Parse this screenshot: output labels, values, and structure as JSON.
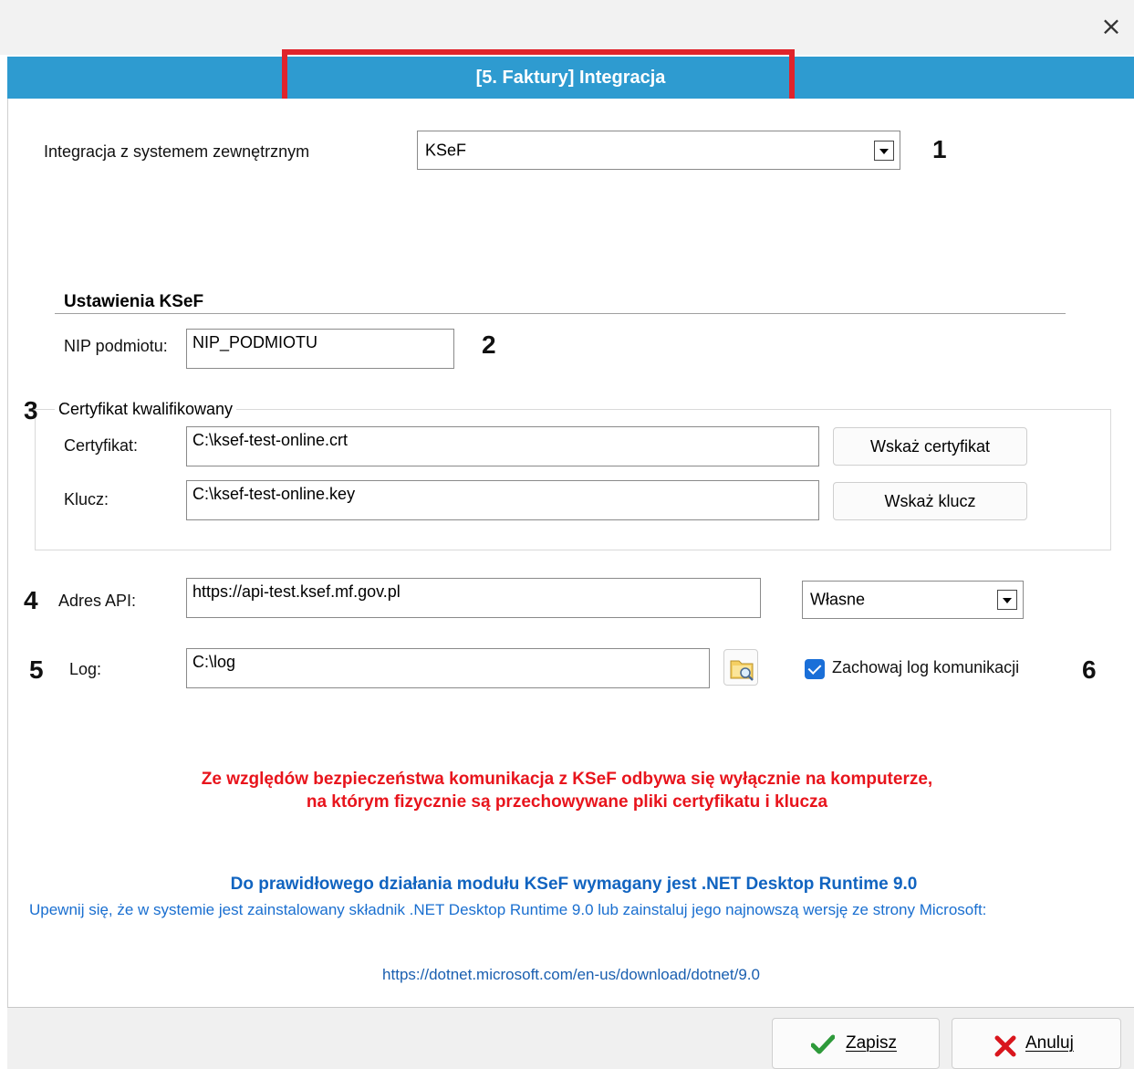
{
  "window": {
    "close_symbol": "×",
    "header_title": "[5. Faktury] Integracja"
  },
  "integration": {
    "label": "Integracja z systemem zewnętrznym",
    "selected": "KSeF",
    "marker": "1"
  },
  "ksef_settings": {
    "section_title": "Ustawienia KSeF",
    "nip_label": "NIP podmiotu:",
    "nip_value": "NIP_PODMIOTU",
    "nip_marker": "2"
  },
  "certificate": {
    "group_label": "Certyfikat kwalifikowany",
    "marker": "3",
    "cert_label": "Certyfikat:",
    "cert_value": "C:\\ksef-test-online.crt",
    "cert_button": "Wskaż certyfikat",
    "key_label": "Klucz:",
    "key_value": "C:\\ksef-test-online.key",
    "key_button": "Wskaż klucz"
  },
  "api": {
    "marker": "4",
    "label": "Adres API:",
    "value": "https://api-test.ksef.mf.gov.pl",
    "mode_selected": "Własne"
  },
  "log": {
    "marker": "5",
    "label": "Log:",
    "value": "C:\\log",
    "keep_log_label": "Zachowaj log komunikacji",
    "keep_log_checked": true,
    "keep_marker": "6"
  },
  "warning": {
    "line1": "Ze względów bezpieczeństwa komunikacja z KSeF odbywa się wyłącznie na komputerze,",
    "line2": "na którym fizycznie są przechowywane pliki certyfikatu i klucza"
  },
  "runtime_info": {
    "title": "Do prawidłowego działania modułu KSeF wymagany jest .NET Desktop Runtime 9.0",
    "text": "Upewnij się, że w systemie jest zainstalowany składnik .NET Desktop Runtime 9.0 lub zainstaluj jego najnowszą wersję ze strony Microsoft:",
    "link": "https://dotnet.microsoft.com/en-us/download/dotnet/9.0"
  },
  "footer": {
    "save_label": "Zapisz",
    "cancel_label": "Anuluj"
  },
  "colors": {
    "header_blue": "#2e9bd0",
    "highlight_red": "#e0242b",
    "warning_red": "#e8141c",
    "info_blue": "#1a6fd0",
    "checkbox_blue": "#1a6fd8"
  }
}
